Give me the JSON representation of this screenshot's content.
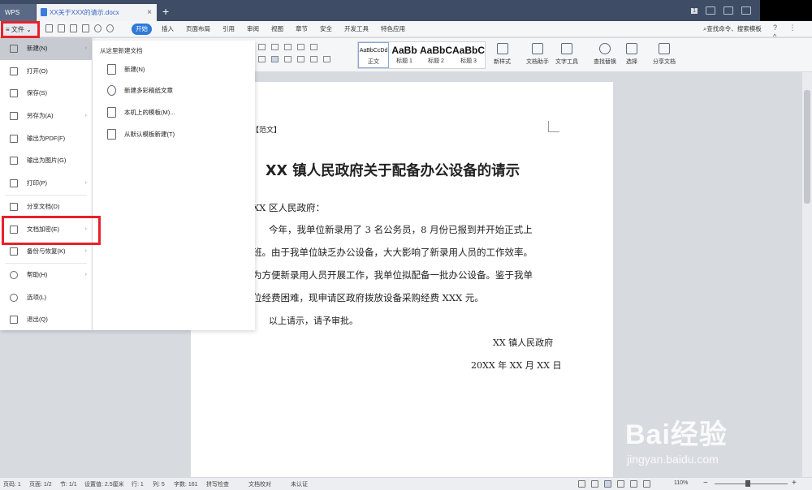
{
  "titlebar": {
    "wps_label": "WPS",
    "doc_tab_title": "XX关于XXX的请示.docx",
    "close_glyph": "×",
    "new_tab_glyph": "+",
    "badge": "1"
  },
  "menubar": {
    "file_label": "文件",
    "tabs": [
      "开始",
      "插入",
      "页面布局",
      "引用",
      "审阅",
      "视图",
      "章节",
      "安全",
      "开发工具",
      "特色应用"
    ],
    "search_command": "查找命令、搜索模板",
    "right_glyphs": "? ⋮ ^"
  },
  "ribbon": {
    "styles": [
      {
        "preview": "AaBbCcDd",
        "name": "正文"
      },
      {
        "preview": "AaBb",
        "name": "标题 1"
      },
      {
        "preview": "AaBbC",
        "name": "标题 2"
      },
      {
        "preview": "AaBbC",
        "name": "标题 3"
      }
    ],
    "buttons": [
      {
        "label": "新样式",
        "icon": "new-style-icon"
      },
      {
        "label": "文档助手",
        "icon": "doc-helper-icon"
      },
      {
        "label": "文字工具",
        "icon": "text-tool-icon"
      },
      {
        "label": "查找替换",
        "icon": "search-icon"
      },
      {
        "label": "选择",
        "icon": "cursor-icon"
      },
      {
        "label": "分享文档",
        "icon": "share-icon"
      }
    ]
  },
  "file_menu": {
    "items": [
      {
        "label": "新建(N)",
        "icon": "new-doc-icon",
        "has_submenu": true
      },
      {
        "label": "打开(O)",
        "icon": "folder-icon",
        "has_submenu": false
      },
      {
        "label": "保存(S)",
        "icon": "save-icon",
        "has_submenu": false
      },
      {
        "label": "另存为(A)",
        "icon": "save-as-icon",
        "has_submenu": true
      },
      {
        "label": "输出为PDF(F)",
        "icon": "pdf-icon",
        "has_submenu": false
      },
      {
        "label": "输出为图片(G)",
        "icon": "image-icon",
        "has_submenu": false
      },
      {
        "label": "打印(P)",
        "icon": "print-icon",
        "has_submenu": true
      },
      {
        "label": "分享文档(D)",
        "icon": "share-icon",
        "has_submenu": false
      },
      {
        "label": "文档加密(E)",
        "icon": "encrypt-icon",
        "has_submenu": true
      },
      {
        "label": "备份与恢复(K)",
        "icon": "backup-icon",
        "has_submenu": true
      },
      {
        "label": "帮助(H)",
        "icon": "help-icon",
        "has_submenu": true
      },
      {
        "label": "选项(L)",
        "icon": "gear-icon",
        "has_submenu": false
      },
      {
        "label": "退出(Q)",
        "icon": "exit-icon",
        "has_submenu": false
      }
    ],
    "arrow_glyph": "›"
  },
  "submenu": {
    "heading": "从这里新建文档",
    "items": [
      {
        "label": "新建(N)",
        "icon": "blank-doc-icon"
      },
      {
        "label": "新建多彩稿纸文章",
        "icon": "colorful-doc-icon"
      },
      {
        "label": "本机上的模板(M)...",
        "icon": "local-template-icon"
      },
      {
        "label": "从默认模板新建(T)",
        "icon": "default-template-icon"
      }
    ]
  },
  "document": {
    "fanwen": "【范文】",
    "title": "XX 镇人民政府关于配备办公设备的请示",
    "salutation": "XX 区人民政府：",
    "lines": [
      "今年，我单位新录用了 3 名公务员，8 月份已报到并开始正式上",
      "班。由于我单位缺乏办公设备，大大影响了新录用人员的工作效率。",
      "为方便新录用人员开展工作，我单位拟配备一批办公设备。鉴于我单",
      "位经费困难，现申请区政府拨放设备采购经费 XXX 元。"
    ],
    "closing": "以上请示，请予审批。",
    "signature": "XX 镇人民政府",
    "date": "20XX 年 XX 月 XX 日"
  },
  "statusbar": {
    "page_no": "页码: 1",
    "pages": "页面: 1/2",
    "section": "节: 1/1",
    "setting": "设置值: 2.5厘米",
    "row": "行: 1",
    "col": "列: 5",
    "words": "字数: 161",
    "spell": "拼写检查",
    "proof": "文档校对",
    "cert": "未认证",
    "zoom": "110%",
    "zoom_minus": "−",
    "zoom_plus": "+"
  },
  "watermark": {
    "main": "Bai经验",
    "sub": "jingyan.baidu.com"
  },
  "accent_color": "#2e7ad9",
  "annotation_color": "#e8212a"
}
